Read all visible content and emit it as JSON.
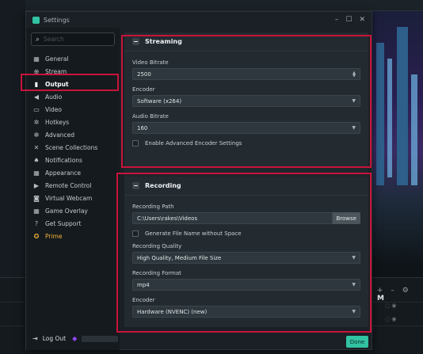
{
  "window": {
    "title": "Settings",
    "controls": {
      "minimize": "–",
      "maximize": "☐",
      "close": "✕"
    }
  },
  "sidebar": {
    "search_placeholder": "Search",
    "items": [
      {
        "label": "General",
        "icon": "grid-icon"
      },
      {
        "label": "Stream",
        "icon": "globe-icon"
      },
      {
        "label": "Output",
        "icon": "output-icon",
        "active": true
      },
      {
        "label": "Audio",
        "icon": "speaker-icon"
      },
      {
        "label": "Video",
        "icon": "video-icon"
      },
      {
        "label": "Hotkeys",
        "icon": "gear-icon"
      },
      {
        "label": "Advanced",
        "icon": "gears-icon"
      },
      {
        "label": "Scene Collections",
        "icon": "tools-icon"
      },
      {
        "label": "Notifications",
        "icon": "bell-icon"
      },
      {
        "label": "Appearance",
        "icon": "appearance-icon"
      },
      {
        "label": "Remote Control",
        "icon": "play-circle-icon"
      },
      {
        "label": "Virtual Webcam",
        "icon": "camera-icon"
      },
      {
        "label": "Game Overlay",
        "icon": "overlay-icon"
      },
      {
        "label": "Get Support",
        "icon": "help-icon"
      },
      {
        "label": "Prime",
        "icon": "prime-icon",
        "color": "#f2b13a"
      }
    ],
    "logout_label": "Log Out"
  },
  "streaming": {
    "title": "Streaming",
    "video_bitrate_label": "Video Bitrate",
    "video_bitrate_value": "2500",
    "encoder_label": "Encoder",
    "encoder_value": "Software (x264)",
    "audio_bitrate_label": "Audio Bitrate",
    "audio_bitrate_value": "160",
    "advanced_checkbox_label": "Enable Advanced Encoder Settings"
  },
  "recording": {
    "title": "Recording",
    "path_label": "Recording Path",
    "path_value": "C:\\Users\\rakes\\Videos",
    "browse_label": "Browse",
    "no_space_label": "Generate File Name without Space",
    "quality_label": "Recording Quality",
    "quality_value": "High Quality, Medium File Size",
    "format_label": "Recording Format",
    "format_value": "mp4",
    "encoder_label": "Encoder",
    "encoder_value": "Hardware (NVENC) (new)"
  },
  "done_label": "Done",
  "background": {
    "controls": [
      "+",
      "–",
      "⚙",
      "M"
    ]
  },
  "colors": {
    "accent": "#31c3a2",
    "highlight": "#c8143a",
    "prime": "#f2b13a"
  }
}
